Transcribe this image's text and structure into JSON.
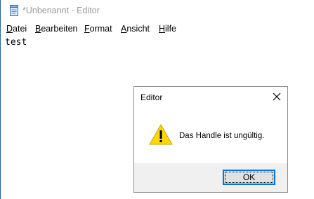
{
  "window": {
    "title": "*Unbenannt - Editor",
    "icon": "notepad-icon"
  },
  "menu": [
    {
      "accel": "D",
      "rest": "atei"
    },
    {
      "accel": "B",
      "rest": "earbeiten"
    },
    {
      "accel": "F",
      "rest": "ormat"
    },
    {
      "accel": "A",
      "rest": "nsicht"
    },
    {
      "accel": "H",
      "rest": "ilfe"
    }
  ],
  "editor": {
    "content": "test"
  },
  "dialog": {
    "title": "Editor",
    "message": "Das Handle ist ungültig.",
    "ok_label": "OK",
    "icon": "warning-icon",
    "close_icon": "close-icon"
  },
  "colors": {
    "focus_border": "#0078d7",
    "warning_yellow": "#ffd800",
    "dialog_bg": "#f0f0f0"
  }
}
